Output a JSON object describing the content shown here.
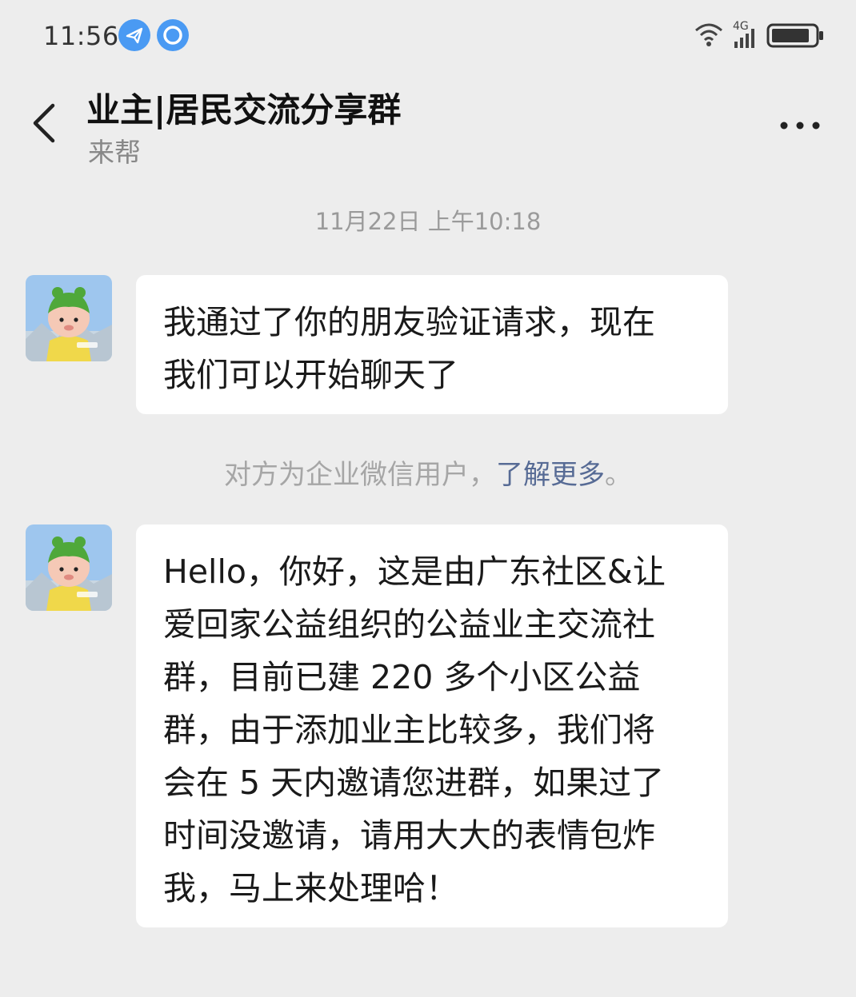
{
  "status_bar": {
    "time": "11:56",
    "network_label": "4G",
    "icons": [
      "telegram-icon",
      "circle-app-icon",
      "wifi-icon",
      "signal-icon",
      "battery-icon"
    ]
  },
  "header": {
    "title": "业主|居民交流分享群",
    "subtitle": "来帮",
    "back_icon": "chevron-left-icon",
    "more_icon": "more-dots-icon"
  },
  "conversation": {
    "timestamp": "11月22日 上午10:18",
    "messages": [
      {
        "lines": [
          "我通过了你的朋友验证请求，现在",
          "我们可以开始聊天了"
        ]
      },
      {
        "lines": [
          "Hello，你好，这是由广东社区&让",
          "爱回家公益组织的公益业主交流社",
          "群，目前已建 220 多个小区公益",
          "群，由于添加业主比较多，我们将",
          "会在 5 天内邀请您进群，如果过了",
          "时间没邀请，请用大大的表情包炸",
          "我，马上来处理哈！"
        ]
      }
    ],
    "system_note": {
      "text": "对方为企业微信用户，",
      "link": "了解更多",
      "suffix": "。"
    }
  },
  "colors": {
    "background": "#ededed",
    "bubble": "#ffffff",
    "link": "#576b95",
    "status_badge": "#4a9af3"
  }
}
